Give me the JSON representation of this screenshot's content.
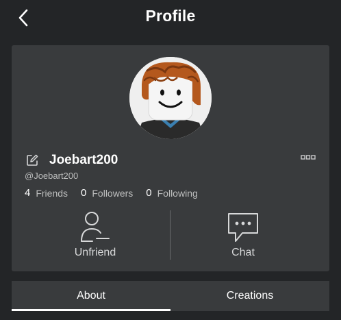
{
  "header": {
    "title": "Profile"
  },
  "profile": {
    "display_name": "Joebart200",
    "username": "@Joebart200"
  },
  "stats": [
    {
      "count": "4",
      "label": "Friends"
    },
    {
      "count": "0",
      "label": "Followers"
    },
    {
      "count": "0",
      "label": "Following"
    }
  ],
  "actions": {
    "unfriend_label": "Unfriend",
    "chat_label": "Chat"
  },
  "tabs": [
    {
      "label": "About",
      "active": true
    },
    {
      "label": "Creations",
      "active": false
    }
  ],
  "colors": {
    "background": "#232527",
    "card": "#393b3d",
    "text_primary": "#ffffff",
    "text_secondary": "#bdbebe"
  }
}
